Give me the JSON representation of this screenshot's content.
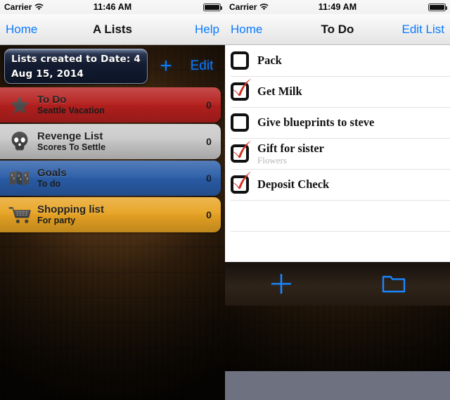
{
  "left": {
    "status_bar": {
      "carrier": "Carrier",
      "time": "11:46 AM",
      "wifi_icon": "wifi-icon",
      "battery_icon": "battery-full-icon"
    },
    "nav": {
      "back_label": "Home",
      "title": "A Lists",
      "right_label": "Help"
    },
    "toolbar": {
      "info_line1": "Lists created to Date: 4",
      "info_line2": "Aug 15, 2014",
      "add_label": "+",
      "edit_label": "Edit"
    },
    "lists": [
      {
        "title": "To Do",
        "subtitle": "Seattle Vacation",
        "count": "0",
        "color": "#b5201e",
        "icon": "star-icon"
      },
      {
        "title": "Revenge List",
        "subtitle": "Scores To Settle",
        "count": "0",
        "color": "#c9c9c9",
        "icon": "skull-icon"
      },
      {
        "title": "Goals",
        "subtitle": "To do",
        "count": "0",
        "color": "#2a5da8",
        "icon": "map-icon"
      },
      {
        "title": "Shopping list",
        "subtitle": "For party",
        "count": "0",
        "color": "#e8a423",
        "icon": "shopping-cart-icon"
      }
    ]
  },
  "right": {
    "status_bar": {
      "carrier": "Carrier",
      "time": "11:49 AM",
      "wifi_icon": "wifi-icon",
      "battery_icon": "battery-full-icon"
    },
    "nav": {
      "back_label": "Home",
      "title": "To Do",
      "right_label": "Edit List"
    },
    "tasks": [
      {
        "title": "Pack",
        "subtitle": "",
        "checked": false
      },
      {
        "title": "Get Milk",
        "subtitle": "",
        "checked": true
      },
      {
        "title": "Give blueprints to steve",
        "subtitle": "",
        "checked": false
      },
      {
        "title": "Gift for sister",
        "subtitle": "Flowers",
        "checked": true
      },
      {
        "title": "Deposit Check",
        "subtitle": "",
        "checked": true
      }
    ],
    "empty_rows": 2,
    "bottom_toolbar": [
      {
        "icon": "plus-icon",
        "color": "#1a86ff"
      },
      {
        "icon": "folder-icon",
        "color": "#1a86ff"
      }
    ]
  },
  "colors": {
    "tint_blue": "#0a7bff",
    "check_red": "#d32f1f",
    "home_strip": "#6e7280"
  }
}
